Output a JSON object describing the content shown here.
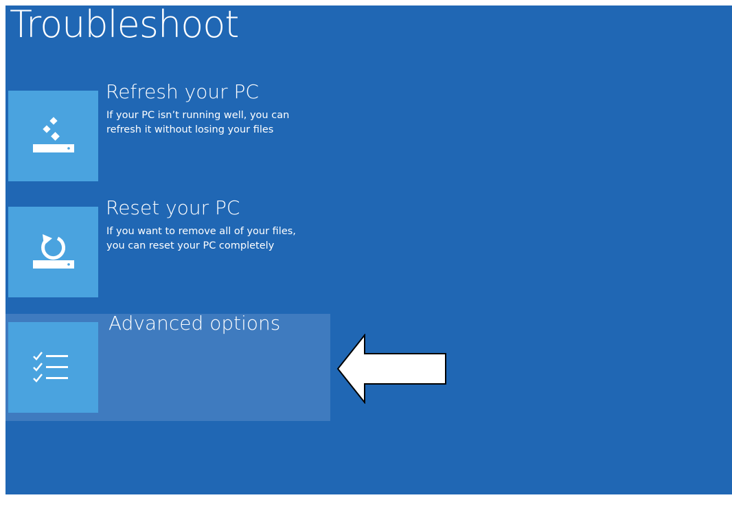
{
  "page": {
    "title": "Troubleshoot"
  },
  "options": [
    {
      "title": "Refresh your PC",
      "description_lines": [
        "If your PC isn’t running well, you can",
        "refresh it without losing your files"
      ],
      "icon": "refresh-pc-icon"
    },
    {
      "title": "Reset your PC",
      "description_lines": [
        "If you want to remove all of your files,",
        "you can reset your PC completely"
      ],
      "icon": "reset-pc-icon"
    },
    {
      "title": "Advanced options",
      "description_lines": [],
      "icon": "checklist-icon",
      "selected": true
    }
  ],
  "colors": {
    "background": "#2067b4",
    "tile": "#4aa3df",
    "selected_row": "#3f7bbf",
    "text": "#ffffff"
  },
  "annotation": {
    "icon": "left-arrow-icon"
  }
}
